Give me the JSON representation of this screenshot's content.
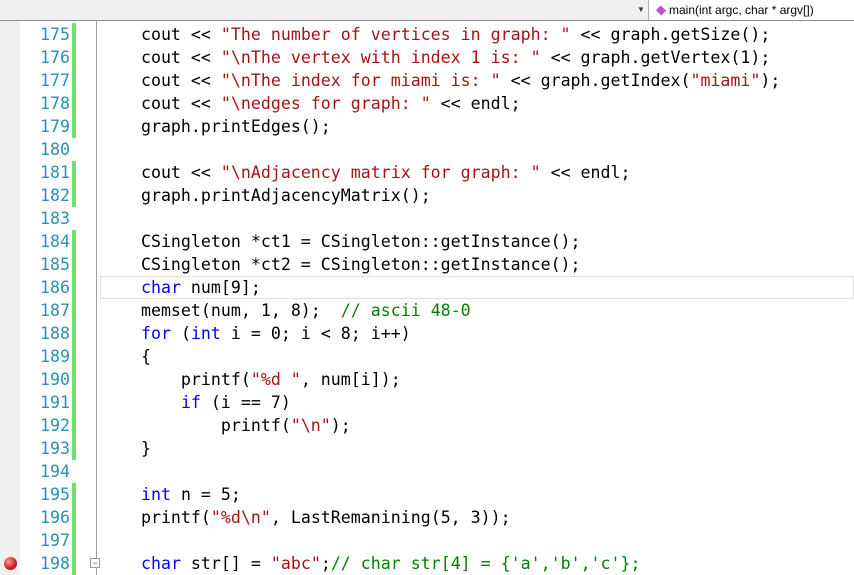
{
  "toolbar": {
    "function_dropdown": "main(int argc, char * argv[])",
    "function_icon": "method-icon"
  },
  "colors": {
    "keyword": "#0000ff",
    "string": "#a31515",
    "comment": "#008000",
    "line_number": "#2b91af",
    "changed_bar": "#6ce26c"
  },
  "current_line": 186,
  "breakpoint_line": 198,
  "lines": [
    {
      "n": "175",
      "chg": true,
      "seg": [
        [
          "",
          "    cout << "
        ],
        [
          "str",
          "\"The number of vertices in graph: \""
        ],
        [
          "",
          " << graph.getSize();"
        ]
      ]
    },
    {
      "n": "176",
      "chg": true,
      "seg": [
        [
          "",
          "    cout << "
        ],
        [
          "str",
          "\"\\nThe vertex with index 1 is: \""
        ],
        [
          "",
          " << graph.getVertex(1);"
        ]
      ]
    },
    {
      "n": "177",
      "chg": true,
      "seg": [
        [
          "",
          "    cout << "
        ],
        [
          "str",
          "\"\\nThe index for miami is: \""
        ],
        [
          "",
          " << graph.getIndex("
        ],
        [
          "str",
          "\"miami\""
        ],
        [
          "",
          ");"
        ]
      ]
    },
    {
      "n": "178",
      "chg": true,
      "seg": [
        [
          "",
          "    cout << "
        ],
        [
          "str",
          "\"\\nedges for graph: \""
        ],
        [
          "",
          " << endl;"
        ]
      ]
    },
    {
      "n": "179",
      "chg": true,
      "seg": [
        [
          "",
          "    graph.printEdges();"
        ]
      ]
    },
    {
      "n": "180",
      "chg": false,
      "seg": []
    },
    {
      "n": "181",
      "chg": true,
      "seg": [
        [
          "",
          "    cout << "
        ],
        [
          "str",
          "\"\\nAdjacency matrix for graph: \""
        ],
        [
          "",
          " << endl;"
        ]
      ]
    },
    {
      "n": "182",
      "chg": true,
      "seg": [
        [
          "",
          "    graph.printAdjacencyMatrix();"
        ]
      ]
    },
    {
      "n": "183",
      "chg": false,
      "seg": []
    },
    {
      "n": "184",
      "chg": true,
      "seg": [
        [
          "",
          "    CSingleton *ct1 = CSingleton::getInstance();"
        ]
      ]
    },
    {
      "n": "185",
      "chg": true,
      "seg": [
        [
          "",
          "    CSingleton *ct2 = CSingleton::getInstance();"
        ]
      ]
    },
    {
      "n": "186",
      "chg": true,
      "seg": [
        [
          "",
          "    "
        ],
        [
          "kw",
          "char"
        ],
        [
          "",
          " num[9];"
        ]
      ]
    },
    {
      "n": "187",
      "chg": true,
      "seg": [
        [
          "",
          "    memset(num, 1, 8);  "
        ],
        [
          "cm",
          "// ascii 48-0"
        ]
      ]
    },
    {
      "n": "188",
      "chg": true,
      "seg": [
        [
          "",
          "    "
        ],
        [
          "kw",
          "for"
        ],
        [
          "",
          " ("
        ],
        [
          "kw",
          "int"
        ],
        [
          "",
          " i = 0; i < 8; i++)"
        ]
      ]
    },
    {
      "n": "189",
      "chg": true,
      "seg": [
        [
          "",
          "    {"
        ]
      ]
    },
    {
      "n": "190",
      "chg": true,
      "seg": [
        [
          "",
          "        printf("
        ],
        [
          "str",
          "\"%d \""
        ],
        [
          "",
          ", num[i]);"
        ]
      ]
    },
    {
      "n": "191",
      "chg": true,
      "seg": [
        [
          "",
          "        "
        ],
        [
          "kw",
          "if"
        ],
        [
          "",
          " (i == 7)"
        ]
      ]
    },
    {
      "n": "192",
      "chg": true,
      "seg": [
        [
          "",
          "            printf("
        ],
        [
          "str",
          "\"\\n\""
        ],
        [
          "",
          ");"
        ]
      ]
    },
    {
      "n": "193",
      "chg": true,
      "seg": [
        [
          "",
          "    }"
        ]
      ]
    },
    {
      "n": "194",
      "chg": false,
      "seg": []
    },
    {
      "n": "195",
      "chg": true,
      "seg": [
        [
          "",
          "    "
        ],
        [
          "kw",
          "int"
        ],
        [
          "",
          " n = 5;"
        ]
      ]
    },
    {
      "n": "196",
      "chg": true,
      "seg": [
        [
          "",
          "    printf("
        ],
        [
          "str",
          "\"%d\\n\""
        ],
        [
          "",
          ", LastRemanining(5, 3));"
        ]
      ]
    },
    {
      "n": "197",
      "chg": true,
      "seg": []
    },
    {
      "n": "198",
      "chg": true,
      "seg": [
        [
          "",
          "    "
        ],
        [
          "kw",
          "char"
        ],
        [
          "",
          " str[] = "
        ],
        [
          "str",
          "\"abc\""
        ],
        [
          "",
          ";"
        ],
        [
          "cm",
          "// char str[4] = {'a','b','c'};"
        ]
      ]
    }
  ]
}
